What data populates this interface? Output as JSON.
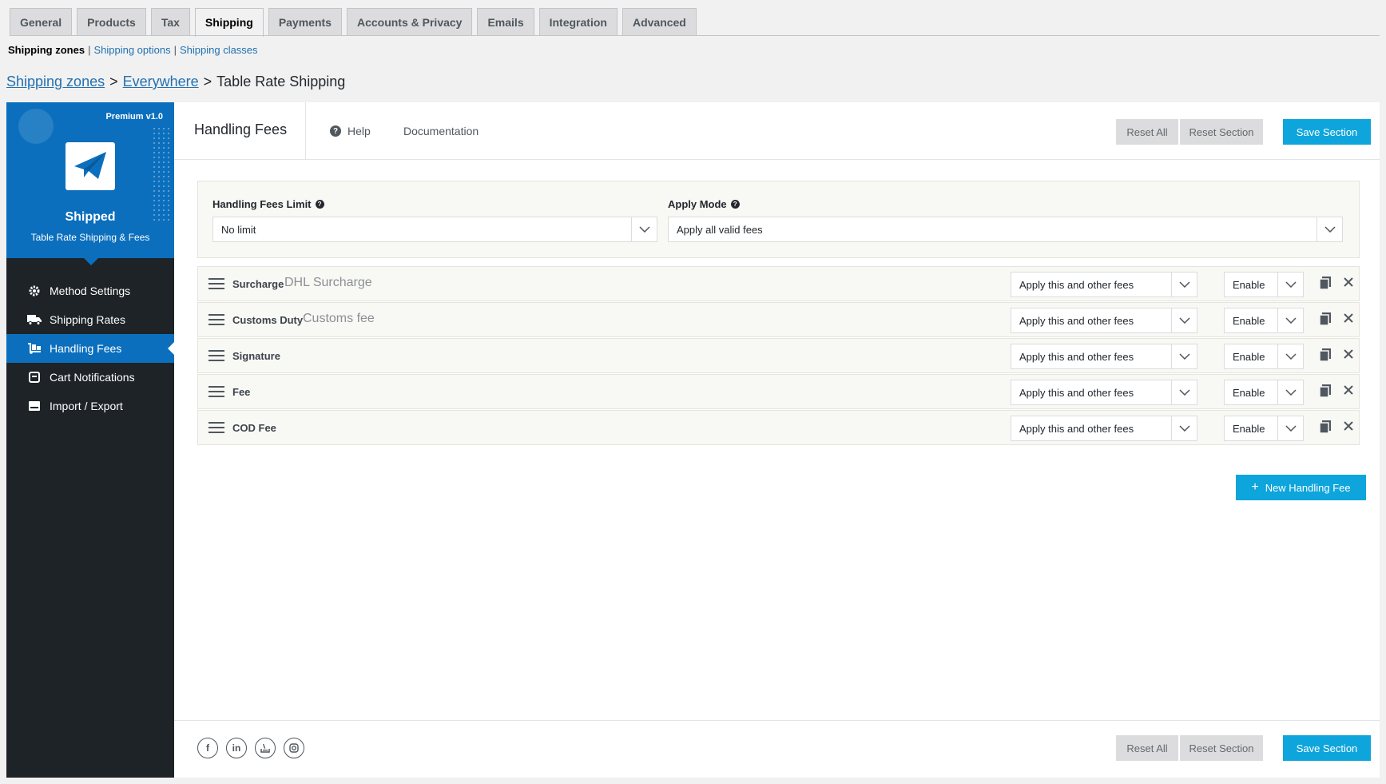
{
  "tabs": [
    {
      "label": "General"
    },
    {
      "label": "Products"
    },
    {
      "label": "Tax"
    },
    {
      "label": "Shipping",
      "active": true
    },
    {
      "label": "Payments"
    },
    {
      "label": "Accounts & Privacy"
    },
    {
      "label": "Emails"
    },
    {
      "label": "Integration"
    },
    {
      "label": "Advanced"
    }
  ],
  "subnav": {
    "current": "Shipping zones",
    "sep": "|",
    "options": "Shipping options",
    "classes": "Shipping classes"
  },
  "breadcrumb": {
    "zones": "Shipping zones",
    "gt": ">",
    "everywhere": "Everywhere",
    "current": "Table Rate Shipping"
  },
  "brand": {
    "version": "Premium v1.0",
    "name": "Shipped",
    "tagline": "Table Rate Shipping & Fees",
    "color": "#0b6fbd"
  },
  "menu": [
    {
      "label": "Method Settings",
      "icon": "gear-icon"
    },
    {
      "label": "Shipping Rates",
      "icon": "truck-icon"
    },
    {
      "label": "Handling Fees",
      "icon": "dolly-icon",
      "active": true
    },
    {
      "label": "Cart Notifications",
      "icon": "notification-icon"
    },
    {
      "label": "Import / Export",
      "icon": "import-export-icon"
    }
  ],
  "header": {
    "title": "Handling Fees",
    "help": "Help",
    "documentation": "Documentation"
  },
  "buttons": {
    "reset_all": "Reset All",
    "reset_section": "Reset Section",
    "save_section": "Save Section",
    "new_fee": "New Handling Fee"
  },
  "limits": {
    "limit_label": "Handling Fees Limit",
    "limit_value": "No limit",
    "mode_label": "Apply Mode",
    "mode_value": "Apply all valid fees"
  },
  "fees": [
    {
      "name": "Surcharge",
      "desc": "DHL Surcharge",
      "mode": "Apply this and other fees",
      "status": "Enable"
    },
    {
      "name": "Customs Duty",
      "desc": "Customs fee",
      "mode": "Apply this and other fees",
      "status": "Enable"
    },
    {
      "name": "Signature",
      "desc": "",
      "mode": "Apply this and other fees",
      "status": "Enable"
    },
    {
      "name": "Fee",
      "desc": "",
      "mode": "Apply this and other fees",
      "status": "Enable"
    },
    {
      "name": "COD Fee",
      "desc": "",
      "mode": "Apply this and other fees",
      "status": "Enable"
    }
  ],
  "social": [
    "facebook-icon",
    "linkedin-icon",
    "stackoverflow-icon",
    "instagram-icon"
  ],
  "colors": {
    "accent": "#0ea5dc",
    "sidebar": "#1d2327"
  }
}
